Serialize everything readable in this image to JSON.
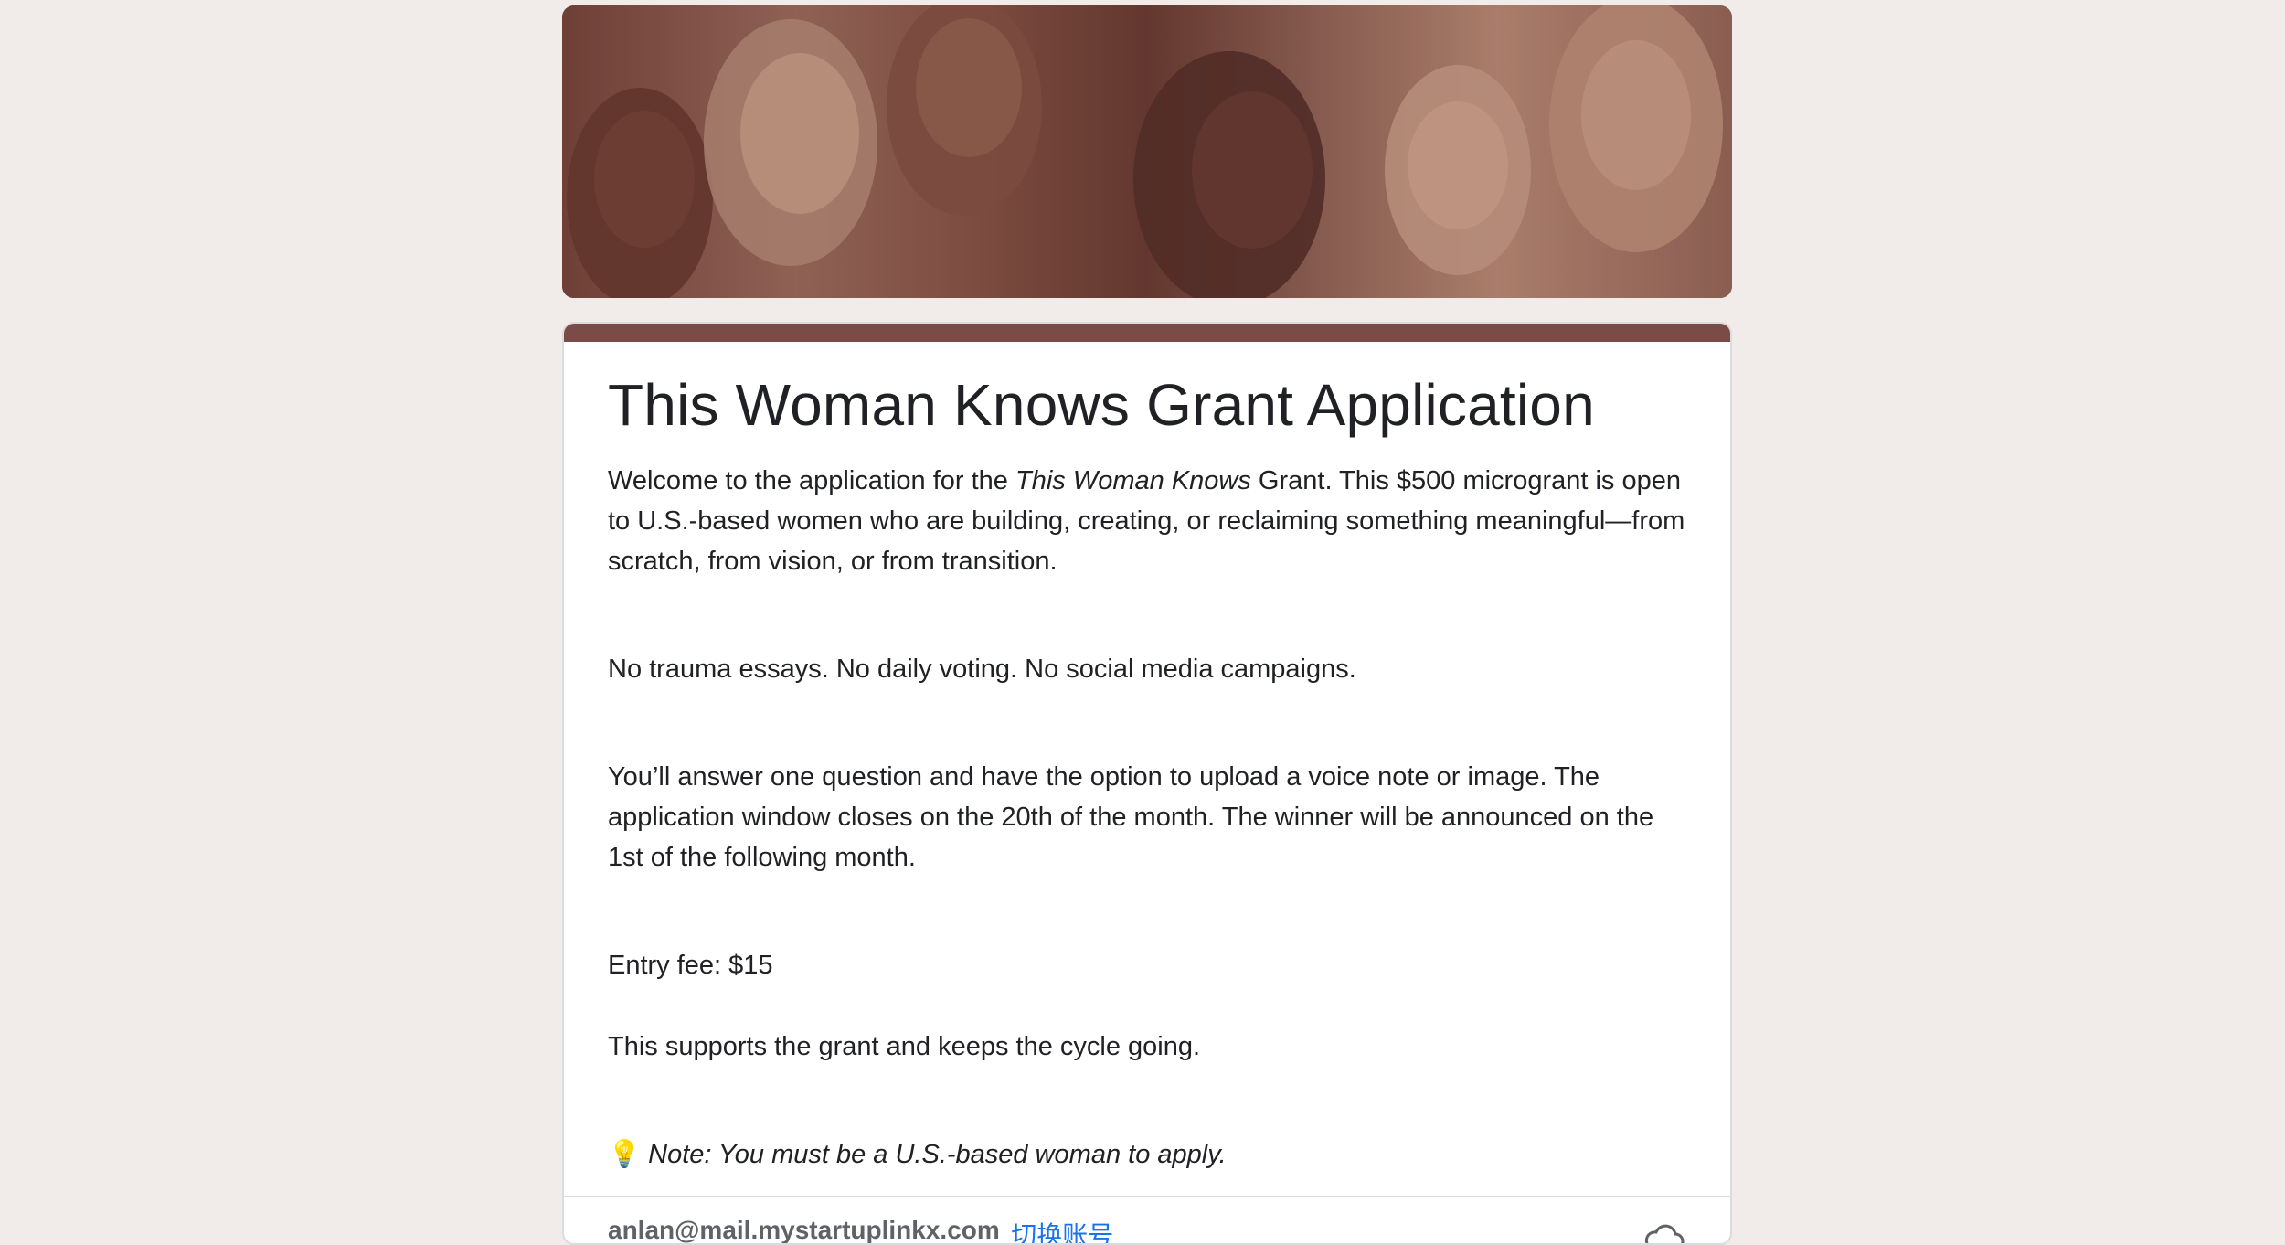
{
  "header_image": {
    "alt": "Six women smiling, pink-brown tinted photo"
  },
  "form": {
    "title": "This Woman Knows Grant Application",
    "intro_prefix": "Welcome to the application for the ",
    "intro_italic": "This Woman Knows",
    "intro_suffix": " Grant. This $500 microgrant is open to U.S.-based women who are building, creating, or reclaiming something meaningful—from scratch, from vision, or from transition.",
    "line2": "No trauma essays. No daily voting. No social media campaigns.",
    "line3": "You’ll answer one question and have the option to upload a voice note or image. The application window closes on the 20th of the month. The winner will be announced on the 1st of the following month.",
    "line4": "Entry fee: $15",
    "line5": "This supports the grant and keeps the cycle going.",
    "note_icon": "💡",
    "note": "Note: You must be a U.S.-based woman to apply."
  },
  "footer": {
    "email": "anlan@mail.mystartuplinkx.com",
    "switch_account": "切换账号",
    "icon": "cloud-icon"
  },
  "colors": {
    "page_bg": "#f1ecea",
    "accent": "#7b4b45",
    "link": "#1a73e8"
  }
}
